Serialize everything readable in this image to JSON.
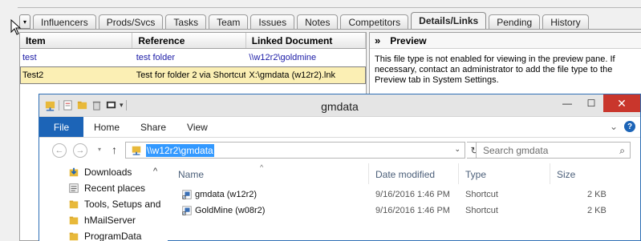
{
  "goldmine": {
    "tab_menu_glyph": "▾",
    "tabs": [
      {
        "label": "Influencers"
      },
      {
        "label": "Prods/Svcs"
      },
      {
        "label": "Tasks"
      },
      {
        "label": "Team"
      },
      {
        "label": "Issues"
      },
      {
        "label": "Notes"
      },
      {
        "label": "Competitors"
      },
      {
        "label": "Details/Links",
        "active": true
      },
      {
        "label": "Pending"
      },
      {
        "label": "History"
      }
    ],
    "grid": {
      "headers": [
        "Item",
        "Reference",
        "Linked Document"
      ],
      "rows": [
        {
          "item": "test",
          "reference": "test folder",
          "document": "\\\\w12r2\\goldmine"
        },
        {
          "item": "Test2",
          "reference": "Test for folder 2 via Shortcut",
          "document": "X:\\gmdata (w12r2).lnk",
          "selected": true
        }
      ]
    },
    "preview": {
      "chevron": "»",
      "title": "Preview",
      "message": "This file type is not enabled for viewing in the preview pane. If necessary, contact an administrator to add the file type to the Preview tab in System Settings."
    }
  },
  "explorer": {
    "title": "gmdata",
    "window_buttons": {
      "minimize": "—",
      "maximize": "☐",
      "close": "✕"
    },
    "ribbon_tabs": [
      "File",
      "Home",
      "Share",
      "View"
    ],
    "ribbon_expand": "⌄",
    "help": "?",
    "nav": {
      "back": "←",
      "forward": "→",
      "recent": "▾",
      "up": "↑"
    },
    "address": "\\\\w12r2\\gmdata",
    "address_dropdown": "⌄",
    "refresh": "↻",
    "search_placeholder": "Search gmdata",
    "search_icon": "⌕",
    "nav_pane": [
      {
        "label": "Downloads",
        "icon": "downloads-icon"
      },
      {
        "label": "Recent places",
        "icon": "recent-places-icon"
      },
      {
        "label": "Tools, Setups and",
        "icon": "folder-icon"
      },
      {
        "label": "hMailServer",
        "icon": "folder-icon"
      },
      {
        "label": "ProgramData",
        "icon": "folder-icon"
      }
    ],
    "nav_collapse": "^",
    "columns": [
      "Name",
      "Date modified",
      "Type",
      "Size"
    ],
    "sort_indicator": "^",
    "files": [
      {
        "name": "gmdata (w12r2)",
        "date": "9/16/2016 1:46 PM",
        "type": "Shortcut",
        "size": "2 KB"
      },
      {
        "name": "GoldMine (w08r2)",
        "date": "9/16/2016 1:46 PM",
        "type": "Shortcut",
        "size": "2 KB"
      }
    ]
  },
  "colors": {
    "file_tab": "#1c64b7",
    "close_button": "#c9362c",
    "selected_row": "#fbefb4",
    "address_selection": "#3399ff",
    "column_header_text": "#4c607a"
  }
}
